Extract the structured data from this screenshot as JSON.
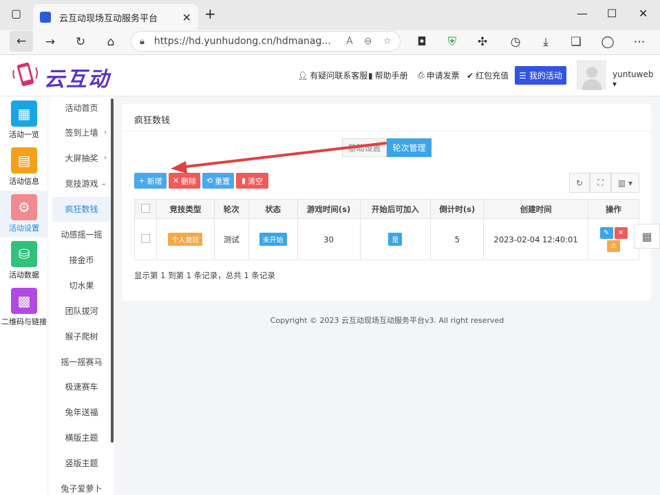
{
  "browser": {
    "tab_title": "云互动现场互动服务平台",
    "url": "https://hd.yunhudong.cn/hdmanag...",
    "new_tab": "+"
  },
  "app": {
    "logo_text": "云互动",
    "links": [
      "有疑问联系客服",
      "帮助手册",
      "申请发票",
      "红包充值"
    ],
    "my_activity": "我的活动",
    "username": "yuntuweb"
  },
  "sidebar1": [
    {
      "label": "活动一览",
      "color": "#17a6e3",
      "icon": "grid-icon"
    },
    {
      "label": "活动信息",
      "color": "#f5a01a",
      "icon": "document-icon"
    },
    {
      "label": "活动设置",
      "color": "#f28a8f",
      "icon": "gear-icon",
      "active": true
    },
    {
      "label": "活动数据",
      "color": "#2fc27b",
      "icon": "database-icon"
    },
    {
      "label": "二维码与链接",
      "color": "#b04ae0",
      "icon": "qrcode-icon"
    }
  ],
  "sidebar2": [
    {
      "label": "活动首页"
    },
    {
      "label": "签到上墙",
      "arrow": "›"
    },
    {
      "label": "大屏抽奖",
      "arrow": "›"
    },
    {
      "label": "竞技游戏",
      "arrow": "⌄"
    },
    {
      "label": "疯狂数钱",
      "active": true
    },
    {
      "label": "动感摇一摇"
    },
    {
      "label": "接金币"
    },
    {
      "label": "切水果"
    },
    {
      "label": "团队拔河"
    },
    {
      "label": "猴子爬树"
    },
    {
      "label": "摇一摇赛马"
    },
    {
      "label": "极速赛车"
    },
    {
      "label": "兔年送福"
    },
    {
      "label": "横版主题"
    },
    {
      "label": "竖版主题"
    },
    {
      "label": "兔子爱萝卜"
    }
  ],
  "card": {
    "title": "疯狂数钱",
    "tabs": [
      "基础设置",
      "轮次管理"
    ],
    "buttons": {
      "add": "新增",
      "delete": "删除",
      "reset": "重置",
      "clear": "清空"
    },
    "table": {
      "headers": [
        "竞技类型",
        "轮次",
        "状态",
        "游戏时间(s)",
        "开始后可加入",
        "倒计时(s)",
        "创建时间",
        "操作"
      ],
      "rows": [
        {
          "type": "个人竞技",
          "round": "测试",
          "status": "未开始",
          "duration": "30",
          "joinable": "是",
          "countdown": "5",
          "created": "2023-02-04 12:40:01"
        }
      ]
    },
    "pagination": "显示第 1 到第 1 条记录，总共 1 条记录"
  },
  "footer": "Copyright © 2023 云互动现场互动服务平台v3. All right reserved",
  "colors": {
    "primary": "#3aa5e8",
    "danger": "#ef5a5a",
    "warning": "#f5a94c",
    "brand": "#5b33c9",
    "arrow": "#e04040"
  }
}
